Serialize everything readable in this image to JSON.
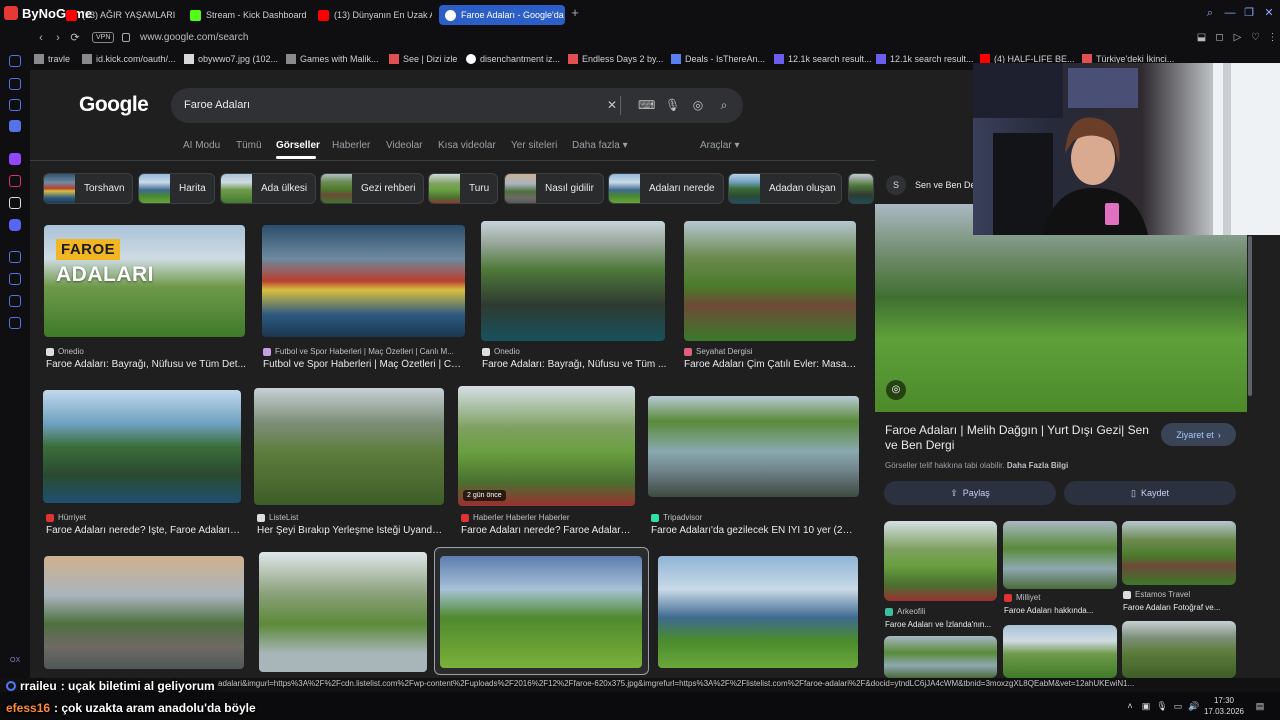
{
  "browser": {
    "brand": "ByNoGame",
    "tabs": [
      {
        "title": "(13) AĞIR YAŞAMLARIN EN",
        "icon": "youtube-icon"
      },
      {
        "title": "Stream - Kick Dashboard",
        "icon": "kick-icon"
      },
      {
        "title": "(13) Dünyanın En Uzak Adı",
        "icon": "youtube-icon"
      },
      {
        "title": "Faroe Adaları - Google'da",
        "icon": "google-icon",
        "active": true
      }
    ],
    "vpn_label": "VPN",
    "url": "www.google.com/search",
    "bookmarks": [
      {
        "label": "travle"
      },
      {
        "label": "id.kick.com/oauth/..."
      },
      {
        "label": "obywwo7.jpg (102..."
      },
      {
        "label": "Games with Malik..."
      },
      {
        "label": "See | Dizi izle"
      },
      {
        "label": "disenchantment iz..."
      },
      {
        "label": "Endless Days 2 by..."
      },
      {
        "label": "Deals - IsThereAn..."
      },
      {
        "label": "12.1k search result..."
      },
      {
        "label": "12.1k search result..."
      },
      {
        "label": "(4) HALF-LIFE BE..."
      },
      {
        "label": "Türkiye'deki İkinci..."
      }
    ]
  },
  "google": {
    "logo": "Google",
    "query": "Faroe Adaları",
    "tabs": [
      "AI Modu",
      "Tümü",
      "Görseller",
      "Haberler",
      "Videolar",
      "Kısa videolar",
      "Yer siteleri",
      "Daha fazla",
      "Araçlar"
    ],
    "active_tab": "Görseller",
    "chips": [
      "Torshavn",
      "Harita",
      "Ada ülkesi",
      "Gezi rehberi",
      "Turu",
      "Nasıl gidilir",
      "Adaları nerede",
      "Adadan oluşan"
    ],
    "results": [
      {
        "source": "Onedio",
        "caption": "Faroe Adaları: Bayrağı, Nüfusu ve Tüm Det...",
        "overlay_top": "FAROE",
        "overlay_bottom": "ADALARI"
      },
      {
        "source": "Futbol ve Spor Haberleri | Maç Özetleri | Canlı M...",
        "caption": "Futbol ve Spor Haberleri | Maç Özetleri | Ca..."
      },
      {
        "source": "Onedio",
        "caption": "Faroe Adaları: Bayrağı, Nüfusu ve Tüm ..."
      },
      {
        "source": "Seyahat Dergisi",
        "caption": "Faroe Adaları Çim Çatılı Evler: Masals..."
      },
      {
        "source": "Hürriyet",
        "caption": "Faroe Adaları nerede? İşte, Faroe Adaları ..."
      },
      {
        "source": "ListeList",
        "caption": "Her Şeyi Bırakıp Yerleşme İsteği Uyandır..."
      },
      {
        "source": "Haberler Haberler Haberler",
        "caption": "Faroe Adaları nerede? Faroe Adaları ...",
        "badge": "2 gün önce"
      },
      {
        "source": "Tripadvisor",
        "caption": "Faroe Adaları'da gezilecek EN İYİ 10 yer (202..."
      }
    ],
    "preview": {
      "header": "Sen ve Ben De",
      "title": "Faroe Adaları | Melih Dağgın | Yurt Dışı Gezi| Sen ve Ben Dergi",
      "visit_label": "Ziyaret et",
      "copyright": "Görseller telif hakkına tabi olabilir.",
      "more_info": "Daha Fazla Bilgi",
      "share_label": "Paylaş",
      "save_label": "Kaydet",
      "related": [
        {
          "source": "Arkeofili",
          "caption": "Faroe Adaları ve İzlanda'nın..."
        },
        {
          "source": "Milliyet",
          "caption": "Faroe Adaları hakkında..."
        },
        {
          "source": "Estamos Travel",
          "caption": "Faroe Adaları Fotoğraf ve..."
        }
      ]
    },
    "status_url": "adalari&imgurl=https%3A%2F%2Fcdn.listelist.com%2Fwp-content%2Fuploads%2F2016%2F12%2Ffaroe-620x375.jpg&imgrefurl=https%3A%2F%2Flistelist.com%2Ffaroe-adalari%2F&docid=ytndLC6jJA4cWM&tbnid=3moxzgXL8QEabM&vet=12ahUKEwiN1..."
  },
  "chat": [
    {
      "user": "rraileu",
      "message": ": uçak biletimi al geliyorum"
    },
    {
      "user": "efess16",
      "message": ": çok uzakta aram anadolu'da böyle"
    }
  ],
  "system": {
    "time": "17:30",
    "date": "17.03.2026",
    "ox_label": "OX"
  }
}
